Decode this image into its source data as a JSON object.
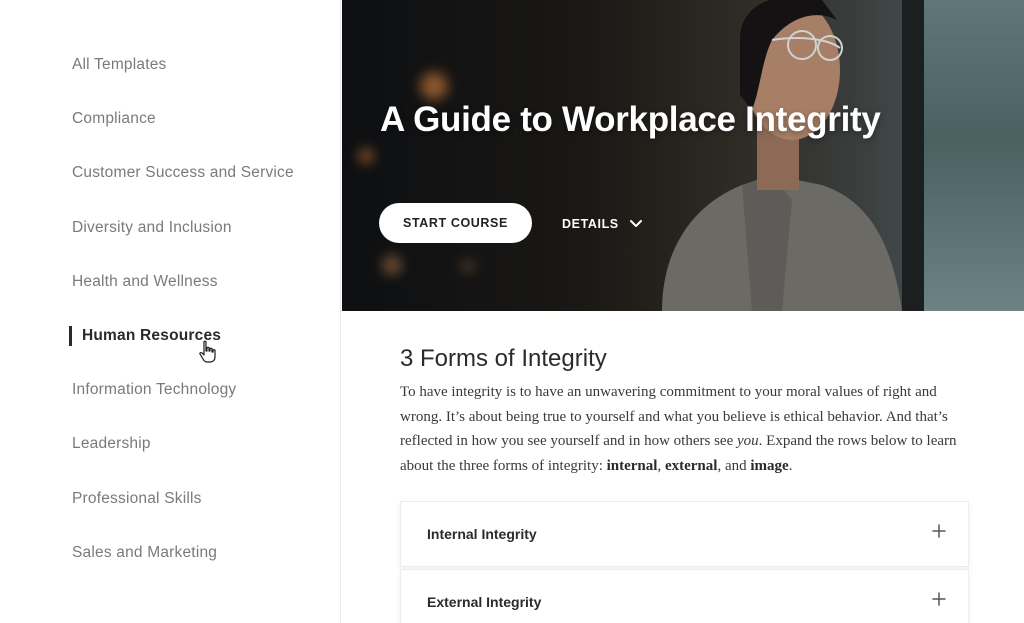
{
  "sidebar": {
    "items": [
      {
        "label": "All Templates",
        "active": false
      },
      {
        "label": "Compliance",
        "active": false
      },
      {
        "label": "Customer Success and Service",
        "active": false
      },
      {
        "label": "Diversity and Inclusion",
        "active": false
      },
      {
        "label": "Health and Wellness",
        "active": false
      },
      {
        "label": "Human Resources",
        "active": true
      },
      {
        "label": "Information Technology",
        "active": false
      },
      {
        "label": "Leadership",
        "active": false
      },
      {
        "label": "Professional Skills",
        "active": false
      },
      {
        "label": "Sales and Marketing",
        "active": false
      }
    ]
  },
  "hero": {
    "title": "A Guide to Workplace Integrity",
    "start_label": "START COURSE",
    "details_label": "DETAILS"
  },
  "content": {
    "section_title": "3 Forms of Integrity",
    "intro": {
      "part1": "To have integrity is to have an unwavering commitment to your moral values of right and wrong. It’s about being true to yourself and what you believe is ethical behavior. And that’s reflected in how you see yourself and in how others see ",
      "emphasis": "you",
      "part2": ". Expand the rows below to learn about the three forms of integrity: ",
      "form1": "internal",
      "sep1": ", ",
      "form2": "external",
      "sep2": ", and ",
      "form3": "image",
      "end": "."
    },
    "accordion": [
      {
        "label": "Internal Integrity"
      },
      {
        "label": "External Integrity"
      }
    ]
  },
  "colors": {
    "active_text": "#2a2a2a",
    "inactive_text": "#7a7a7a",
    "hero_text": "#ffffff"
  }
}
